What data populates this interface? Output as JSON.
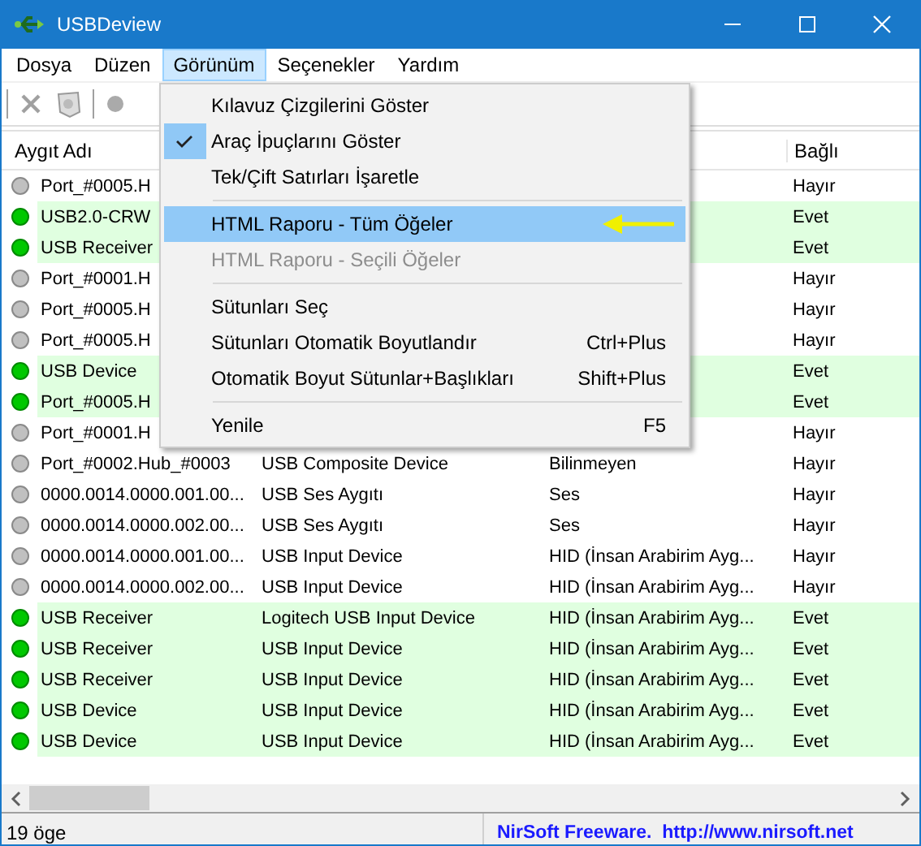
{
  "window": {
    "title": "USBDeview"
  },
  "menu_bar": [
    {
      "label": "Dosya",
      "selected": false
    },
    {
      "label": "Düzen",
      "selected": false
    },
    {
      "label": "Görünüm",
      "selected": true
    },
    {
      "label": "Seçenekler",
      "selected": false
    },
    {
      "label": "Yardım",
      "selected": false
    }
  ],
  "dropdown": [
    {
      "kind": "item",
      "label": "Kılavuz Çizgilerini Göster",
      "checked": false,
      "disabled": false,
      "selected": false
    },
    {
      "kind": "item",
      "label": "Araç İpuçlarını Göster",
      "checked": true,
      "disabled": false,
      "selected": false
    },
    {
      "kind": "item",
      "label": "Tek/Çift Satırları İşaretle",
      "checked": false,
      "disabled": false,
      "selected": false
    },
    {
      "kind": "separator"
    },
    {
      "kind": "item",
      "label": "HTML Raporu - Tüm Öğeler",
      "checked": false,
      "disabled": false,
      "selected": true
    },
    {
      "kind": "item",
      "label": "HTML Raporu - Seçili Öğeler",
      "checked": false,
      "disabled": true,
      "selected": false
    },
    {
      "kind": "separator"
    },
    {
      "kind": "item",
      "label": "Sütunları Seç",
      "checked": false,
      "disabled": false,
      "selected": false
    },
    {
      "kind": "item",
      "label": "Sütunları Otomatik Boyutlandır",
      "shortcut": "Ctrl+Plus",
      "checked": false,
      "disabled": false,
      "selected": false
    },
    {
      "kind": "item",
      "label": "Otomatik Boyut Sütunlar+Başlıkları",
      "shortcut": "Shift+Plus",
      "checked": false,
      "disabled": false,
      "selected": false
    },
    {
      "kind": "separator"
    },
    {
      "kind": "item",
      "label": "Yenile",
      "shortcut": "F5",
      "checked": false,
      "disabled": false,
      "selected": false
    }
  ],
  "table": {
    "columns": {
      "column_1": "Aygıt Adı",
      "column_4": "Bağlı"
    },
    "rows": [
      {
        "name": "Port_#0005.H",
        "connected": false,
        "bagli": "Hayır"
      },
      {
        "name": "USB2.0-CRW",
        "connected": true,
        "bagli": "Evet"
      },
      {
        "name": "USB Receiver",
        "connected": true,
        "bagli": "Evet"
      },
      {
        "name": "Port_#0001.H",
        "connected": false,
        "bagli": "Hayır"
      },
      {
        "name": "Port_#0005.H",
        "connected": false,
        "bagli": "Hayır"
      },
      {
        "name": "Port_#0005.H",
        "connected": false,
        "bagli": "Hayır"
      },
      {
        "name": "USB Device",
        "connected": true,
        "bagli": "Evet"
      },
      {
        "name": "Port_#0005.H",
        "connected": true,
        "bagli": "Evet"
      },
      {
        "name": "Port_#0001.H",
        "connected": false,
        "bagli": "Hayır"
      },
      {
        "name": "Port_#0002.Hub_#0003",
        "column_2": "USB Composite Device",
        "column_3": "Bilinmeyen",
        "connected": false,
        "bagli": "Hayır"
      },
      {
        "name": "0000.0014.0000.001.00...",
        "column_2": "USB Ses Aygıtı",
        "column_3": "Ses",
        "connected": false,
        "bagli": "Hayır"
      },
      {
        "name": "0000.0014.0000.002.00...",
        "column_2": "USB Ses Aygıtı",
        "column_3": "Ses",
        "connected": false,
        "bagli": "Hayır"
      },
      {
        "name": "0000.0014.0000.001.00...",
        "column_2": "USB Input Device",
        "column_3": "HID (İnsan Arabirim Ayg...",
        "connected": false,
        "bagli": "Hayır"
      },
      {
        "name": "0000.0014.0000.002.00...",
        "column_2": "USB Input Device",
        "column_3": "HID (İnsan Arabirim Ayg...",
        "connected": false,
        "bagli": "Hayır"
      },
      {
        "name": "USB Receiver",
        "column_2": "Logitech USB Input Device",
        "column_3": "HID (İnsan Arabirim Ayg...",
        "connected": true,
        "bagli": "Evet"
      },
      {
        "name": "USB Receiver",
        "column_2": "USB Input Device",
        "column_3": "HID (İnsan Arabirim Ayg...",
        "connected": true,
        "bagli": "Evet"
      },
      {
        "name": "USB Receiver",
        "column_2": "USB Input Device",
        "column_3": "HID (İnsan Arabirim Ayg...",
        "connected": true,
        "bagli": "Evet"
      },
      {
        "name": "USB Device",
        "column_2": "USB Input Device",
        "column_3": "HID (İnsan Arabirim Ayg...",
        "connected": true,
        "bagli": "Evet"
      },
      {
        "name": "USB Device",
        "column_2": "USB Input Device",
        "column_3": "HID (İnsan Arabirim Ayg...",
        "connected": true,
        "bagli": "Evet"
      }
    ]
  },
  "status_bar": {
    "count": "19 öge",
    "link": "NirSoft Freeware.  http://www.nirsoft.net"
  }
}
